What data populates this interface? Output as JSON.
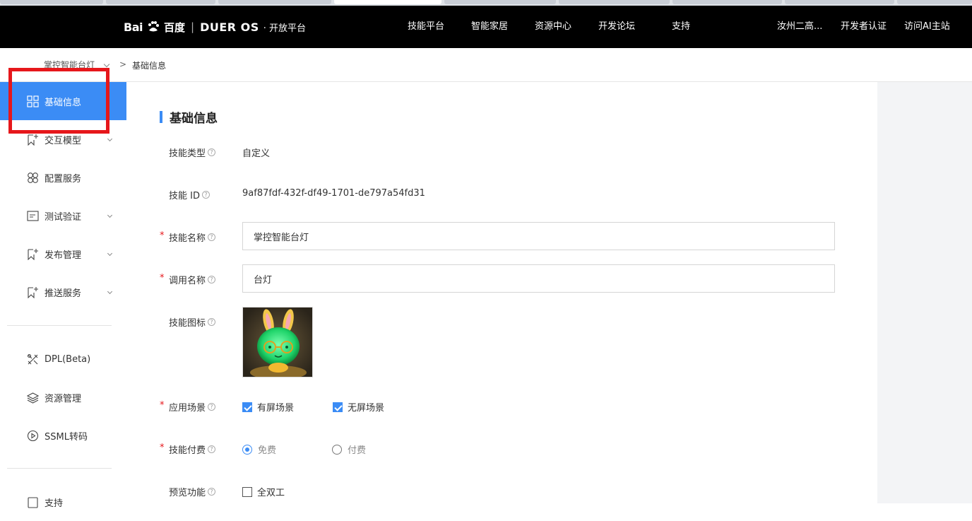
{
  "topnav": {
    "logo_bai": "Bai",
    "logo_baidu": "百度",
    "logo_duer": "DUER",
    "logo_os": "OS",
    "logo_platform": "· 开放平台",
    "items": [
      "技能平台",
      "智能家居",
      "资源中心",
      "开发论坛",
      "支持"
    ],
    "user": "汝州二高...",
    "dev_cert": "开发者认证",
    "visit_ai": "访问AI主站"
  },
  "breadcrumb": {
    "skill": "掌控智能台灯",
    "separator": ">",
    "current": "基础信息"
  },
  "sidebar": {
    "items": [
      {
        "label": "基础信息",
        "icon": "grid-icon"
      },
      {
        "label": "交互模型",
        "icon": "bookmark-plus-icon"
      },
      {
        "label": "配置服务",
        "icon": "clover-icon"
      },
      {
        "label": "测试验证",
        "icon": "document-icon"
      },
      {
        "label": "发布管理",
        "icon": "bookmark-plus-icon"
      },
      {
        "label": "推送服务",
        "icon": "bookmark-plus-icon"
      },
      {
        "label": "DPL(Beta)",
        "icon": "tools-icon"
      },
      {
        "label": "资源管理",
        "icon": "layers-icon"
      },
      {
        "label": "SSML转码",
        "icon": "play-circle-icon"
      },
      {
        "label": "支持",
        "icon": "document-icon"
      }
    ]
  },
  "form": {
    "section_title": "基础信息",
    "required_mark": "*",
    "skill_type_label": "技能类型",
    "skill_type_value": "自定义",
    "skill_id_label": "技能 ID",
    "skill_id_value": "9af87fdf-432f-df49-1701-de797a54fd31",
    "skill_name_label": "技能名称",
    "skill_name_value": "掌控智能台灯",
    "invoke_name_label": "调用名称",
    "invoke_name_value": "台灯",
    "skill_icon_label": "技能图标",
    "scene_label": "应用场景",
    "scene_screen": "有屏场景",
    "scene_noscreen": "无屏场景",
    "fee_label": "技能付费",
    "fee_free": "免费",
    "fee_paid": "付费",
    "preview_label": "预览功能",
    "preview_duplex": "全双工"
  },
  "colors": {
    "accent": "#3b8cf5",
    "highlight": "#e6171b",
    "topbar": "#000000"
  }
}
